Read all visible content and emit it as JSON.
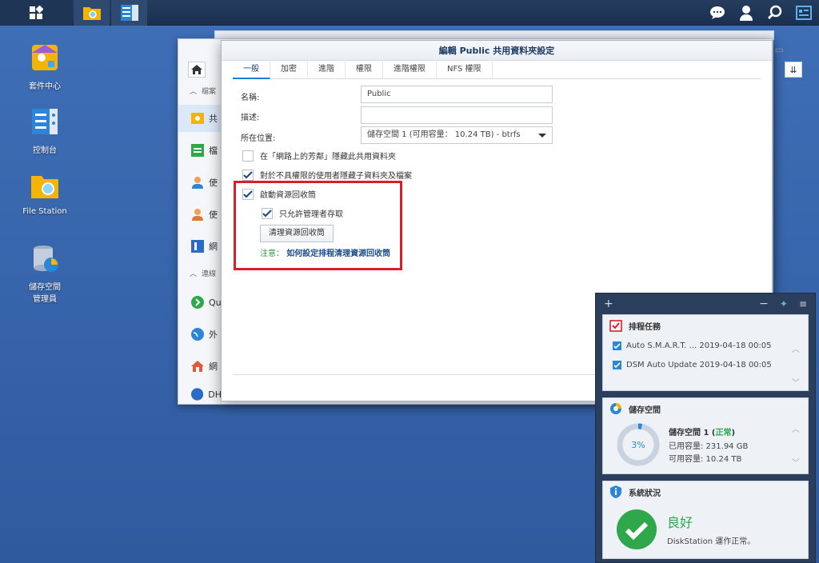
{
  "desktop": {
    "icons": [
      {
        "label": "套件中心"
      },
      {
        "label": "控制台"
      },
      {
        "label": "File Station"
      },
      {
        "label": "儲存空間\n管理員"
      }
    ]
  },
  "background_window": {
    "sidebar": {
      "section_files": "檔案",
      "items": [
        "共",
        "檔",
        "使",
        "使",
        "網"
      ],
      "section_connect": "連線",
      "items2": [
        "Qu",
        "外",
        "網",
        "DH"
      ]
    }
  },
  "dialog": {
    "title": "編輯 Public 共用資料夾設定",
    "tabs": [
      "一般",
      "加密",
      "進階",
      "權限",
      "進階權限",
      "NFS 權限"
    ],
    "fields": {
      "name_label": "名稱:",
      "name_value": "Public",
      "desc_label": "描述:",
      "desc_value": "",
      "location_label": "所在位置:",
      "location_value": "儲存空間 1 (可用容量： 10.24 TB) - btrfs"
    },
    "checkboxes": {
      "hide_network": {
        "label": "在「網路上的芳鄰」隱藏此共用資料夾",
        "checked": false
      },
      "hide_unauth": {
        "label": "對於不具權限的使用者隱藏子資料夾及檔案",
        "checked": true
      },
      "recycle_bin": {
        "label": "啟動資源回收筒",
        "checked": true
      },
      "admin_only": {
        "label": "只允許管理者存取",
        "checked": true
      }
    },
    "clean_button": "清理資源回收筒",
    "note_prefix": "注意：",
    "note_link": "如何設定排程清理資源回收筒"
  },
  "widgets": {
    "scheduled_tasks": {
      "title": "排程任務",
      "rows": [
        "Auto S.M.A.R.T. ... 2019-04-18 00:05",
        "DSM Auto Update 2019-04-18 00:05"
      ]
    },
    "storage": {
      "title": "儲存空間",
      "volume_label": "儲存空間 1 (",
      "volume_status": "正常",
      "volume_close": ")",
      "percent": "3%",
      "used": "已用容量: 231.94 GB",
      "available": "可用容量: 10.24 TB"
    },
    "system": {
      "title": "系統狀況",
      "status": "良好",
      "detail": "DiskStation 運作正常。"
    }
  },
  "colors": {
    "accent": "#1c7dd6",
    "highlight": "#d8202a",
    "ok": "#2ea84a"
  }
}
